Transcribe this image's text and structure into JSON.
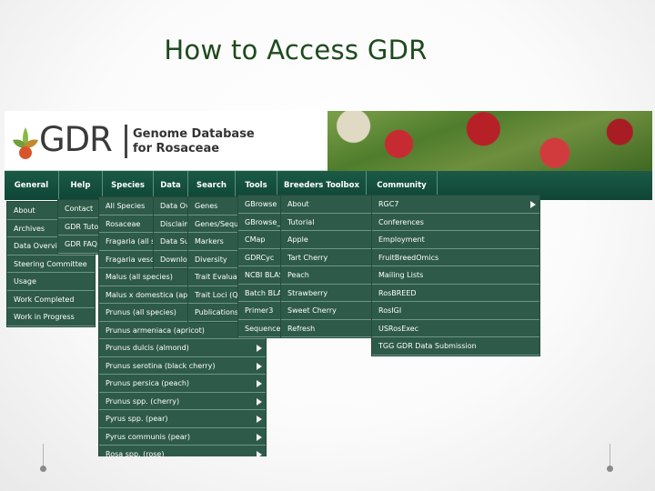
{
  "slide_title": "How to Access GDR",
  "logo": {
    "text": "GDR",
    "subtitle_line1": "Genome Database",
    "subtitle_line2": "for Rosaceae",
    "leaf_colors": [
      "#8ab845",
      "#d9542c",
      "#c08a2d"
    ]
  },
  "nav": [
    {
      "label": "General"
    },
    {
      "label": "Help"
    },
    {
      "label": "Species"
    },
    {
      "label": "Data"
    },
    {
      "label": "Search"
    },
    {
      "label": "Tools"
    },
    {
      "label": "Breeders Toolbox"
    },
    {
      "label": "Community"
    }
  ],
  "menus": {
    "general": [
      "About",
      "Archives",
      "Data Overview",
      "Steering Committee",
      "Usage",
      "Work Completed",
      "Work in Progress"
    ],
    "help": [
      "Contact",
      "GDR Tutorials",
      "GDR FAQ"
    ],
    "species": [
      "All Species",
      "Rosaceae",
      "Fragaria (all species)",
      "Fragaria vesca",
      "Malus (all species)",
      "Malus x domestica (apple)",
      "Prunus (all species)",
      "Prunus armeniaca (apricot)",
      "Prunus dulcis (almond)",
      "Prunus serotina (black cherry)",
      "Prunus persica (peach)",
      "Prunus spp. (cherry)",
      "Pyrus spp. (pear)",
      "Pyrus communis (pear)",
      "Rosa spp. (rose)"
    ],
    "data": [
      "Data Overview",
      "Disclaimer",
      "Data Submission",
      "Downloads"
    ],
    "search": [
      "Genes",
      "Genes/Sequences",
      "Markers",
      "Diversity",
      "Trait Evaluation",
      "Trait Loci (QTL)",
      "Publications"
    ],
    "tools": [
      "GBrowse",
      "GBrowse_syn",
      "CMap",
      "GDRCyc",
      "NCBI BLAST",
      "Batch BLAST",
      "Primer3",
      "Sequence Retrieval"
    ],
    "breeders": [
      "About",
      "Tutorial",
      "Apple",
      "Tart Cherry",
      "Peach",
      "Strawberry",
      "Sweet Cherry",
      "Refresh"
    ],
    "community": [
      "RGC7",
      "Conferences",
      "Employment",
      "FruitBreedOmics",
      "Mailing Lists",
      "RosBREED",
      "RosIGI",
      "USRosExec",
      "TGG GDR Data Submission"
    ]
  },
  "colors": {
    "title": "#1e4a1e",
    "navbar": "#0f4536",
    "menu_bg": "#2e5a49"
  }
}
